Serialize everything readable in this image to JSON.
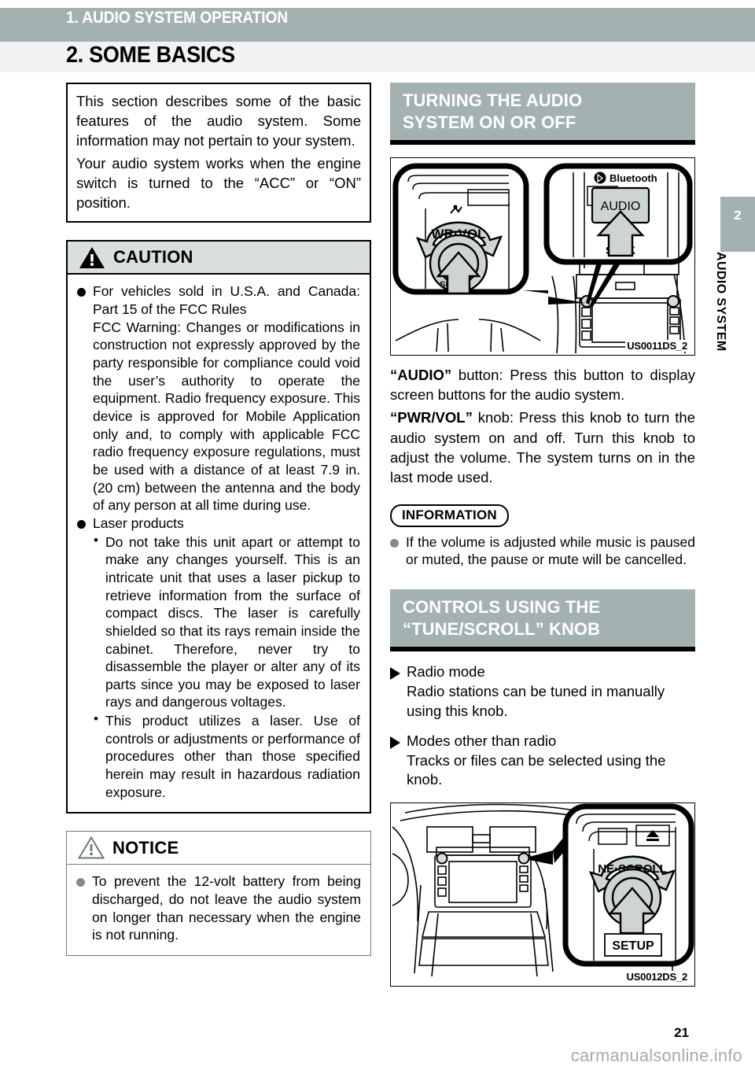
{
  "header": {
    "running_title": "1. AUDIO SYSTEM OPERATION",
    "page_title": "2. SOME BASICS",
    "band_color": "#a4b1b1"
  },
  "side_tab": {
    "number": "2",
    "label": "AUDIO SYSTEM"
  },
  "left_column": {
    "intro": {
      "paragraph_1": "This section describes some of the basic features of the audio system. Some information may not pertain to your system.",
      "paragraph_2": "Your audio system works when the engine switch is turned to the “ACC” or “ON” position."
    },
    "caution": {
      "title": "CAUTION",
      "icon": "warning-triangle-icon",
      "items": [
        {
          "heading": "For vehicles sold in U.S.A. and Canada: Part 15 of the FCC Rules",
          "body": "FCC Warning: Changes or modifications in construction not expressly approved by the party responsible for compliance could void the user’s authority to operate the equipment. Radio frequency exposure. This device is approved for Mobile Application only and, to comply with applicable FCC radio frequency exposure regulations, must be used with a distance of at least 7.9 in. (20 cm) between the antenna and the body of any person at all time during use."
        },
        {
          "heading": "Laser products",
          "sub_items": [
            "Do not take this unit apart or attempt to make any changes yourself. This is an intricate unit that uses a laser pickup to retrieve information from the surface of compact discs. The laser is carefully shielded so that its rays remain inside the cabinet. Therefore, never try to disassemble the player or alter any of its parts since you may be exposed to laser rays and dangerous voltages.",
            "This product utilizes a laser. Use of controls or adjustments or performance of procedures other than those specified herein may result in hazardous radiation exposure."
          ]
        }
      ]
    },
    "notice": {
      "title": "NOTICE",
      "icon": "warning-triangle-outline-icon",
      "items": [
        "To prevent the 12-volt battery from being discharged, do not leave the audio system on longer than necessary when the engine is not running."
      ]
    }
  },
  "right_column": {
    "section_1": {
      "heading_line_1": "TURNING THE AUDIO",
      "heading_line_2": "SYSTEM ON OR OFF",
      "figure": {
        "id": "US0011DS_2",
        "labels": {
          "bluetooth": "Bluetooth",
          "audio_button": "AUDIO",
          "knob": "PWR·VOL",
          "seek": "SEEK"
        }
      },
      "body": [
        {
          "bold": "“AUDIO”",
          "text": " button: Press this button to display screen buttons for the audio system."
        },
        {
          "bold": "“PWR/VOL”",
          "text": " knob: Press this knob to turn the audio system on and off. Turn this knob to adjust the volume. The system turns on in the last mode used."
        }
      ],
      "information": {
        "title": "INFORMATION",
        "items": [
          "If the volume is adjusted while music is paused or muted, the pause or mute will be cancelled."
        ]
      }
    },
    "section_2": {
      "heading_line_1": "CONTROLS USING THE",
      "heading_line_2": "“TUNE/SCROLL” KNOB",
      "entries": [
        {
          "heading": "Radio mode",
          "body": "Radio stations can be tuned in manually using this knob."
        },
        {
          "heading": "Modes other than radio",
          "body": "Tracks or files can be selected using the knob."
        }
      ],
      "figure": {
        "id": "US0012DS_2",
        "labels": {
          "knob": "TUNE·SCROLL",
          "setup": "SETUP"
        }
      }
    }
  },
  "footer": {
    "page_number": "21",
    "watermark": "carmanualsonline.info"
  }
}
